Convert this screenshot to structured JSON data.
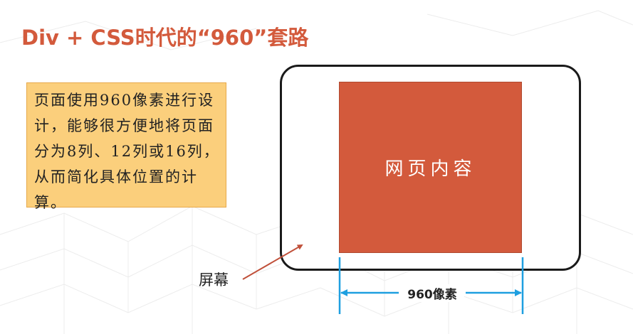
{
  "slide": {
    "title": "Div + CSS时代的“960”套路"
  },
  "note": {
    "text": "页面使用960像素进行设计，能够很方便地将页面分为8列、12列或16列，从而简化具体位置的计算。"
  },
  "diagram": {
    "content_label": "网页内容",
    "screen_label": "屏幕",
    "width_label": "960像素"
  },
  "colors": {
    "accent": "#d35a3c",
    "note_fill": "#fbcf7c",
    "dimension_line": "#1e9fe0",
    "pointer_arrow": "#c0503a"
  }
}
